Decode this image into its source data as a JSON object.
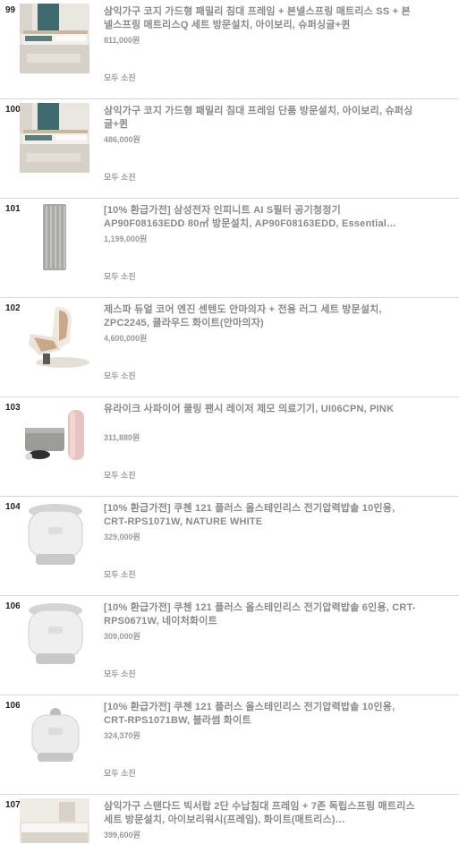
{
  "items": [
    {
      "rank": "99",
      "title": "삼익가구 코지 가드형 패밀리 침대 프레임 + 본넬스프링 매트리스 SS + 본넬스프링 매트리스Q 세트 방문설치, 아이보리, 슈퍼싱글+퀸",
      "price": "811,000원",
      "status": "모두 소진",
      "image": "family-bed-image"
    },
    {
      "rank": "100",
      "title": "삼익가구 코지 가드형 패밀리 침대 프레임 단품 방문설치, 아이보리, 슈퍼싱글+퀸",
      "price": "486,000원",
      "status": "모두 소진",
      "image": "family-bed-image"
    },
    {
      "rank": "101",
      "title": "[10% 환급가전] 삼성전자 인피니트 AI S필터 공기청정기 AP90F08163EDD 80㎡ 방문설치, AP90F08163EDD, Essential…",
      "price": "1,199,000원",
      "status": "모두 소진",
      "image": "air-purifier-image"
    },
    {
      "rank": "102",
      "title": "제스파 듀얼 코어 엔진 센텐도 안마의자 + 전용 러그 세트 방문설치, ZPC2245, 클라우드 화이트(안마의자)",
      "price": "4,600,000원",
      "status": "모두 소진",
      "image": "massage-chair-image"
    },
    {
      "rank": "103",
      "title": "유라이크 사파이어 쿨링 팬시 레이저 제모 의료기기, UI06CPN, PINK",
      "price": "311,880원",
      "status": "모두 소진",
      "image": "laser-device-image"
    },
    {
      "rank": "104",
      "title": "[10% 환급가전] 쿠첸 121 플러스 올스테인리스 전기압력밥솥 10인용, CRT-RPS1071W, NATURE WHITE",
      "price": "329,000원",
      "status": "모두 소진",
      "image": "rice-cooker-image"
    },
    {
      "rank": "106",
      "title": "[10% 환급가전] 쿠첸 121 플러스 올스테인리스 전기압력밥솥 6인용, CRT-RPS0671W, 네이처화이트",
      "price": "309,000원",
      "status": "모두 소진",
      "image": "rice-cooker-image"
    },
    {
      "rank": "106",
      "title": "[10% 환급가전] 쿠첸 121 플러스 올스테인리스 전기압력밥솥 10인용, CRT-RPS1071BW, 블라썸 화이트",
      "price": "324,370원",
      "status": "모두 소진",
      "image": "rice-cooker-small-image"
    },
    {
      "rank": "107",
      "title": "삼익가구 스탠다드 빅서랍 2단 수납침대 프레임 + 7존 독립스프링 매트리스 세트 방문설치, 아이보리워시(프레임), 화이트(매트리스)…",
      "price": "399,600원",
      "status": "",
      "image": "storage-bed-image"
    }
  ]
}
